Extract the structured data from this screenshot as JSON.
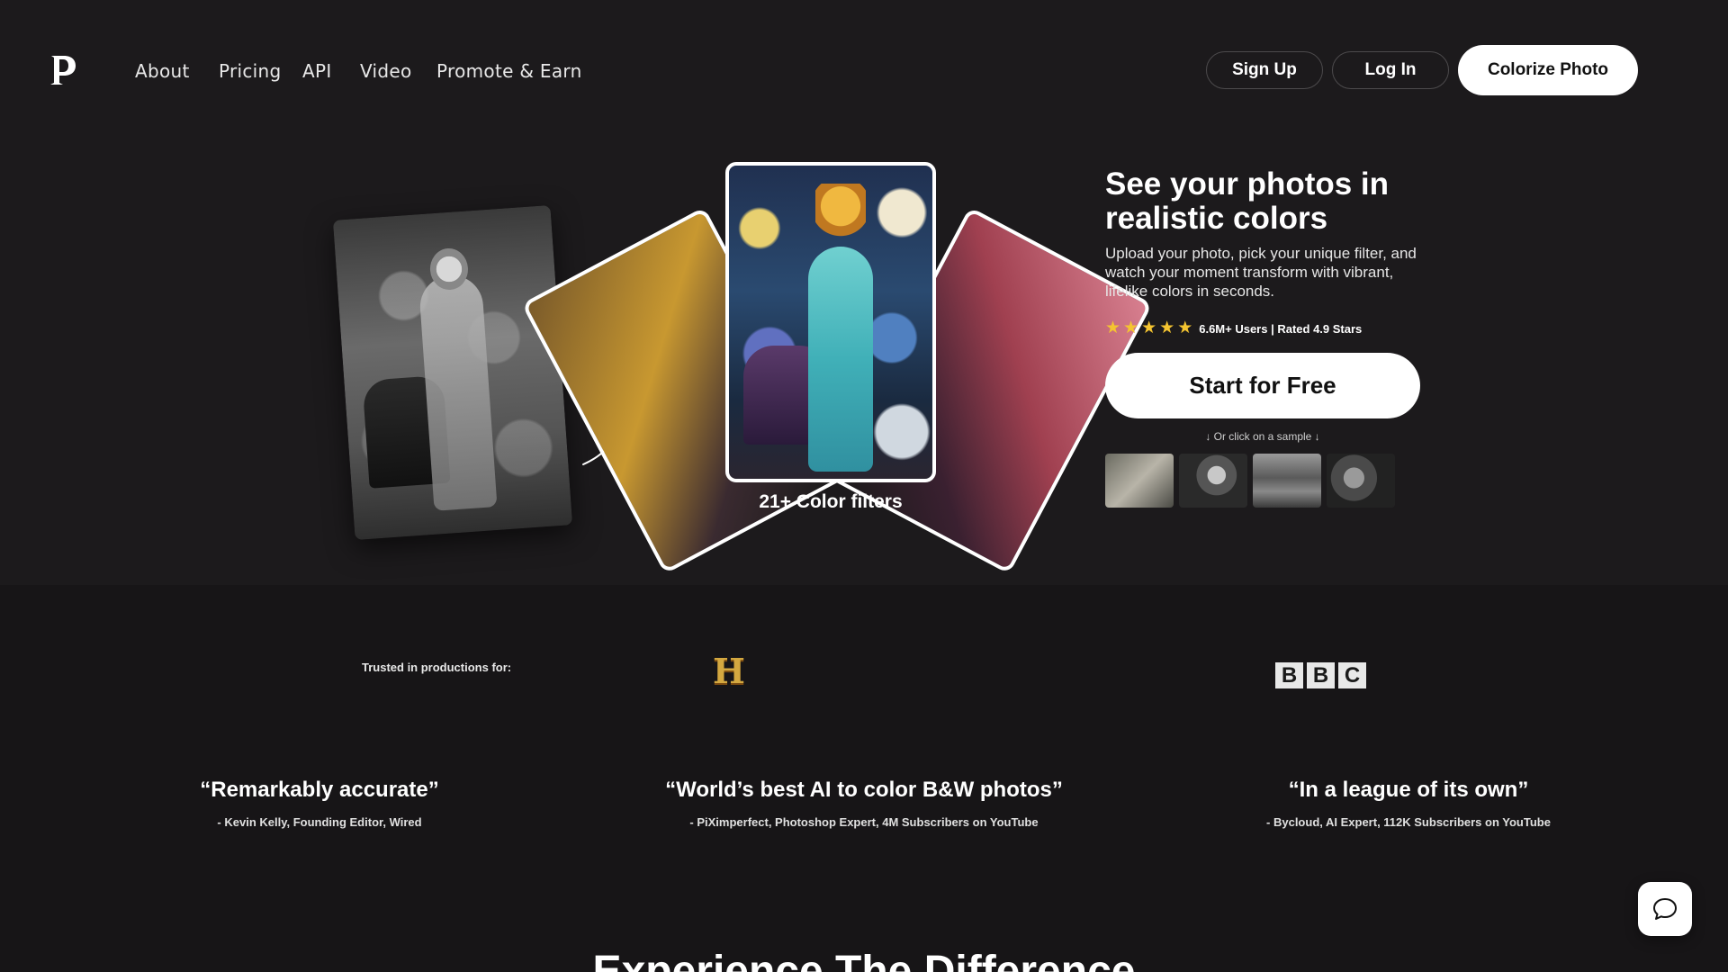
{
  "brand": {
    "logo_letter": "P"
  },
  "nav": {
    "links": [
      "About",
      "Pricing",
      "API",
      "Video",
      "Promote & Earn"
    ],
    "sign_up": "Sign Up",
    "log_in": "Log In",
    "colorize": "Colorize Photo"
  },
  "hero": {
    "filters_label": "21+ Color filters",
    "title": "See your photos in realistic colors",
    "description": "Upload your photo, pick your unique filter, and watch your moment transform with vibrant, lifelike colors in seconds.",
    "stars": 5,
    "rating_text": "6.6M+ Users | Rated 4.9 Stars",
    "cta": "Start for Free",
    "sample_hint": "↓ Or click on a sample ↓"
  },
  "trusted": {
    "label": "Trusted in productions for:",
    "history_logo": "H",
    "bbc_letters": [
      "B",
      "B",
      "C"
    ]
  },
  "quotes": [
    {
      "text": "“Remarkably accurate”",
      "source": "- Kevin Kelly, Founding Editor, Wired"
    },
    {
      "text": "“World’s best AI to color B&W photos”",
      "source": "- PiXimperfect, Photoshop Expert, 4M Subscribers on YouTube"
    },
    {
      "text": "“In a league of its own”",
      "source": "- Bycloud, AI Expert, 112K Subscribers on YouTube"
    }
  ],
  "section": {
    "title": "Experience The Difference"
  },
  "colors": {
    "background": "#1c1a1c",
    "star": "#f4c430",
    "accent_button": "#ffffff"
  },
  "icons": {
    "chat": "chat-bubble-icon",
    "arrow": "curly-arrow-icon",
    "star": "star-icon"
  }
}
